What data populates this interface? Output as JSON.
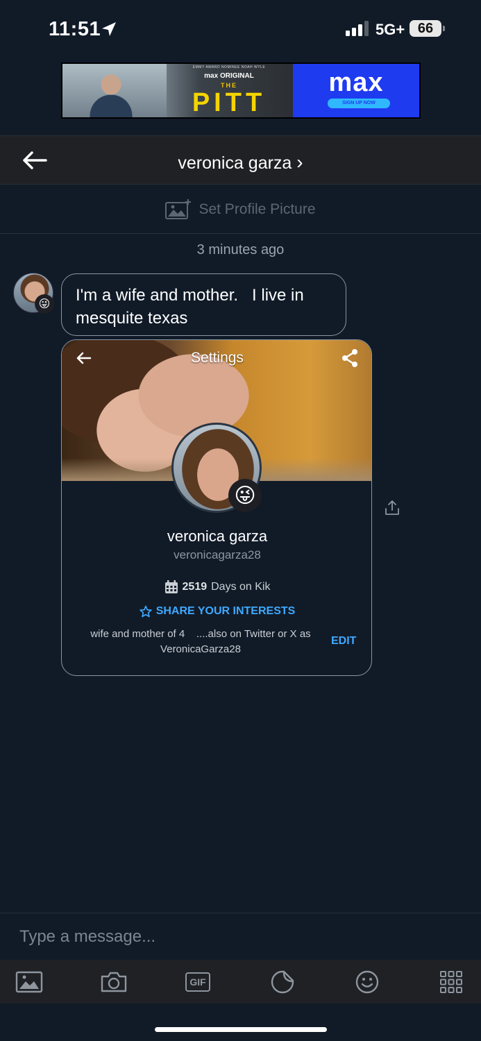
{
  "status": {
    "time": "11:51",
    "network": "5G+",
    "battery": "66"
  },
  "ad": {
    "tagline": "EMMY AWARD NOMINEE NOAH WYLE",
    "small": "max ORIGINAL",
    "the": "THE",
    "title": "PITT",
    "brand": "max",
    "cta": "SIGN UP NOW"
  },
  "header": {
    "contact_name": "veronica garza",
    "chevron": "›"
  },
  "profile_picture": {
    "label": "Set Profile Picture"
  },
  "timestamp": "3 minutes ago",
  "message": {
    "text": "I'm a wife and mother.   I live in mesquite texas",
    "avatar_emoji": "😜"
  },
  "profile_card": {
    "title": "Settings",
    "name": "veronica garza",
    "username": "veronicagarza28",
    "days_count": "2519",
    "days_label": "Days on Kik",
    "interests_label": "SHARE YOUR INTERESTS",
    "bio": "wife and mother of 4    ....also on Twitter or X as VeronicaGarza28",
    "edit_label": "EDIT",
    "emoji": "😜"
  },
  "composer": {
    "placeholder": "Type a message..."
  },
  "toolbar": {
    "gif_label": "GIF",
    "icons": [
      "gallery-icon",
      "camera-icon",
      "gif-icon",
      "sticker-icon",
      "emoji-icon",
      "apps-grid-icon"
    ]
  },
  "colors": {
    "background": "#111b28",
    "header": "#1f2125",
    "accent": "#3fa9ff",
    "border": "#8a96a4"
  }
}
